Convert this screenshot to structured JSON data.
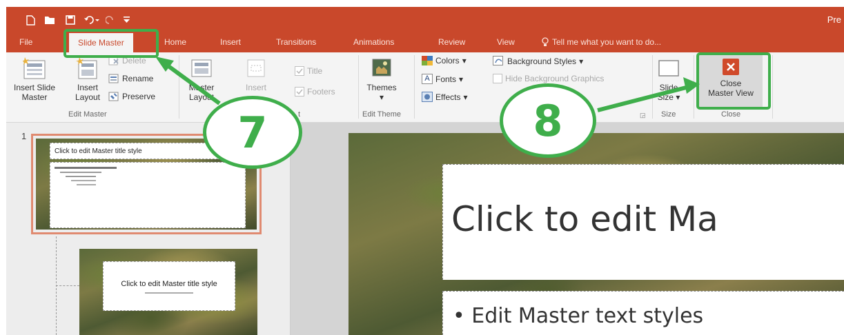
{
  "qat": {
    "new": "new-icon",
    "open": "open-icon",
    "save": "save-icon",
    "undo": "undo-icon",
    "redo": "redo-icon",
    "customize": "customize-icon"
  },
  "window": {
    "title": "Pre"
  },
  "tabs": [
    "File",
    "Slide Master",
    "Home",
    "Insert",
    "Transitions",
    "Animations",
    "Review",
    "View"
  ],
  "tell_me": "Tell me what you want to do...",
  "ribbon": {
    "edit_master": {
      "insert_slide_master": [
        "Insert Slide",
        "Master"
      ],
      "insert_layout": [
        "Insert",
        "Layout"
      ],
      "delete": "Delete",
      "rename": "Rename",
      "preserve": "Preserve",
      "label": "Edit Master"
    },
    "master_layout": {
      "master_layout": [
        "Master",
        "Layout"
      ],
      "insert": "Insert",
      "title": "Title",
      "footers": "Footers",
      "label": "t"
    },
    "edit_theme": {
      "themes": "Themes",
      "label": "Edit Theme"
    },
    "background": {
      "colors": "Colors",
      "fonts": "Fonts",
      "effects": "Effects",
      "background_styles": "Background Styles",
      "hide_background": "Hide Background Graphics"
    },
    "size": {
      "slide_size": [
        "Slide",
        "Size"
      ],
      "label": "Size"
    },
    "close": {
      "close_master_view": [
        "Close",
        "Master View"
      ],
      "label": "Close"
    }
  },
  "thumbnails": {
    "number": "1",
    "master_title": "Click to edit Master title style",
    "layout_title": "Click to edit Master title style"
  },
  "slide": {
    "title": "Click to edit Ma",
    "bullet": "Edit Master text styles"
  },
  "annotations": {
    "step7": "7",
    "step8": "8"
  },
  "colors": {
    "accent": "#c9482b",
    "annotation": "#3fae4b"
  }
}
